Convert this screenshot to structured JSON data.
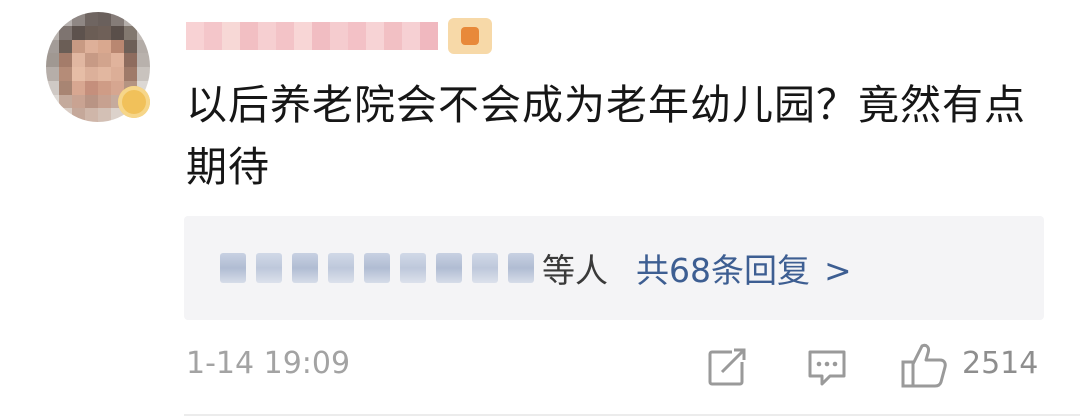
{
  "comment": {
    "username": "",
    "text": "以后养老院会不会成为老年幼儿园？竟然有点期待",
    "timestamp": "1-14 19:09"
  },
  "replies": {
    "others_suffix": "等人",
    "count_label": "共68条回复",
    "chevron": ">"
  },
  "actions": {
    "share_icon": "share-icon",
    "comment_icon": "comment-icon",
    "like_icon": "thumbs-up-icon",
    "like_count": "2514"
  },
  "colors": {
    "link": "#3d5e92",
    "muted": "#a3a3a3",
    "reply_bg": "#f4f4f6"
  }
}
